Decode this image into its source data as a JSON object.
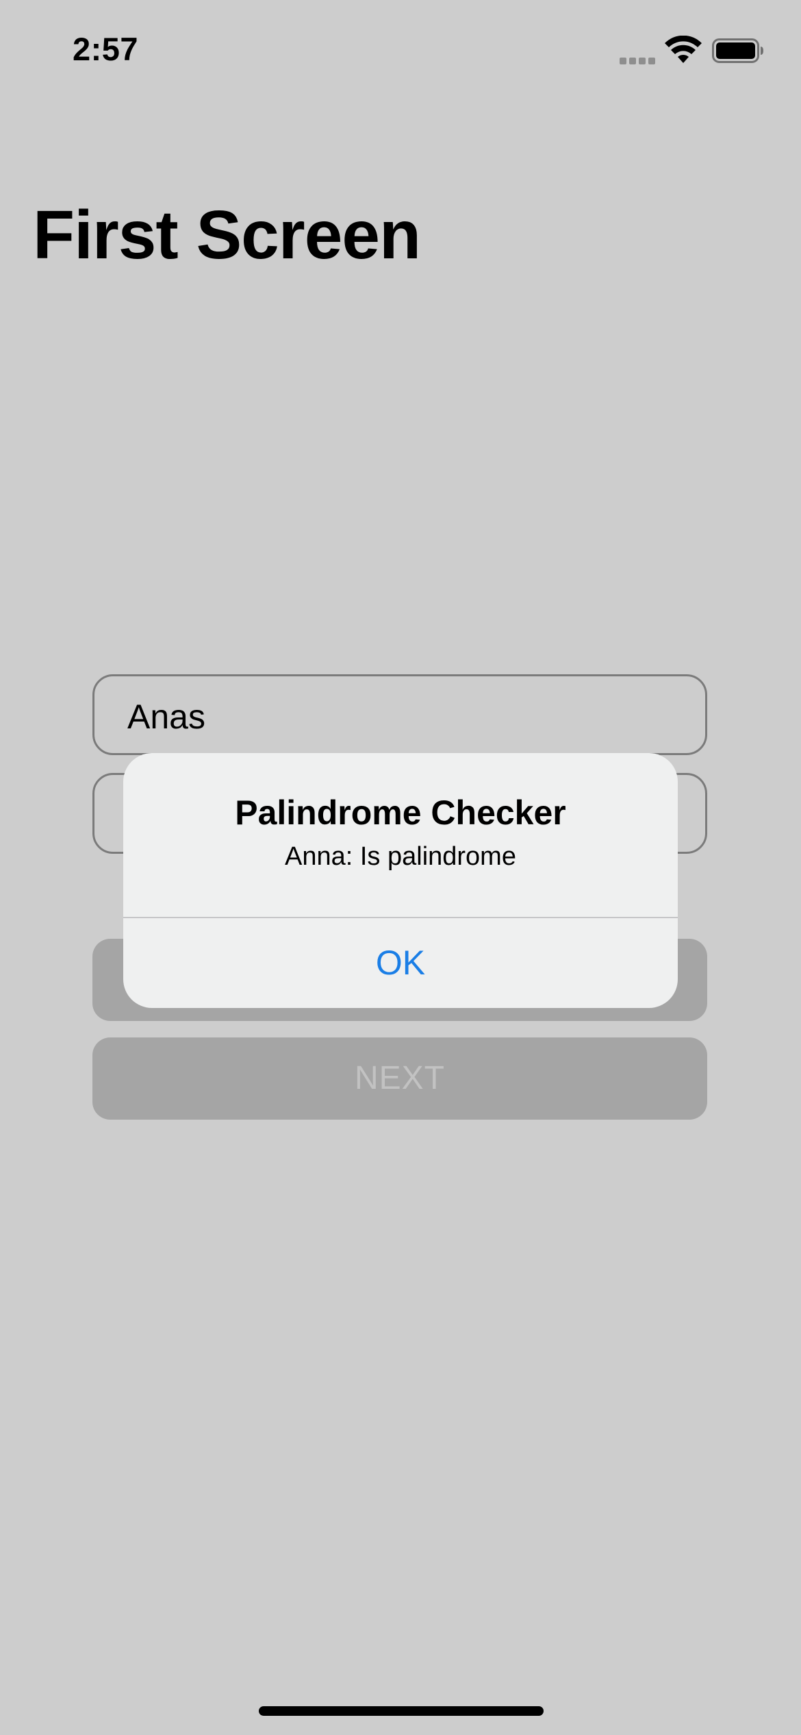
{
  "status_bar": {
    "time": "2:57",
    "icons": [
      "cellular-signal-icon",
      "wifi-icon",
      "battery-icon"
    ]
  },
  "page": {
    "title": "First Screen"
  },
  "form": {
    "name_value": "Anas",
    "sentence_value": "",
    "check_label": "",
    "next_label": "NEXT"
  },
  "alert": {
    "title": "Palindrome Checker",
    "message": "Anna: Is palindrome",
    "ok_label": "OK"
  },
  "colors": {
    "background": "#cdcdcd",
    "alert_background": "#eff0f0",
    "accent": "#1a7ee6",
    "disabled_button": "#a5a5a5"
  }
}
